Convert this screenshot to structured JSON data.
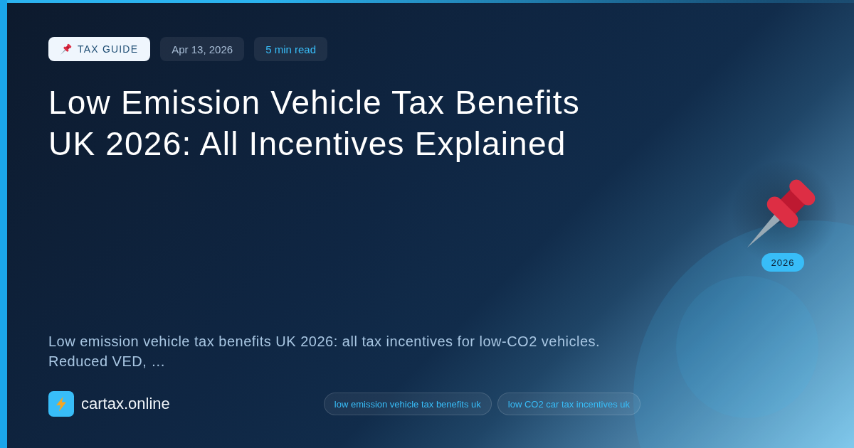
{
  "badges": [
    {
      "kind": "category",
      "label": "TAX GUIDE"
    },
    {
      "kind": "date",
      "label": "Apr 13, 2026"
    },
    {
      "kind": "reading_time",
      "label": "5 min read"
    }
  ],
  "title": "Low Emission Vehicle Tax Benefits UK 2026: All Incentives Explained",
  "description": "Low emission vehicle tax benefits UK 2026: all tax incentives for low-CO2 vehicles. Reduced VED, …",
  "brand": {
    "name": "cartax.online"
  },
  "tags": [
    "low emission vehicle tax benefits uk",
    "low CO2 car tax incentives uk"
  ],
  "illustration": {
    "year_badge": "2026"
  }
}
